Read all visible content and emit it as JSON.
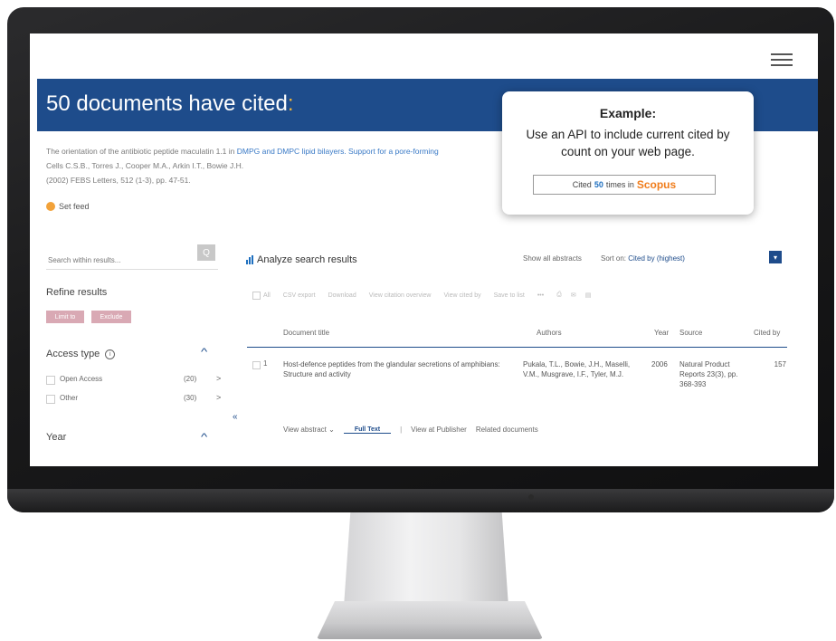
{
  "header": {
    "title_main": "50 documents have cited",
    "title_colon": ":"
  },
  "citation": {
    "line1_before": "The orientation of the antibiotic peptide maculatin 1.1 in ",
    "line1_link": "DMPG and DMPC lipid bilayers. Support for a pore-forming",
    "line2": "Cells C.S.B., Torres J., Cooper M.A., Arkin I.T., Bowie J.H.",
    "line3": "(2002) FEBS Letters, 512 (1-3), pp. 47-51.",
    "set_feed": "Set feed"
  },
  "callout": {
    "heading": "Example:",
    "body": "Use an API to include current cited by count on your web page.",
    "badge_before": "Cited",
    "badge_number": "50",
    "badge_after": "times in",
    "badge_brand": "Scopus"
  },
  "sidebar": {
    "search_placeholder": "Search within results...",
    "search_button": "Q",
    "refine_title": "Refine results",
    "limit_label": "Limit to",
    "exclude_label": "Exclude",
    "access_type": {
      "title": "Access type",
      "info": "i",
      "items": [
        {
          "label": "Open Access",
          "count": "(20)"
        },
        {
          "label": "Other",
          "count": "(30)"
        }
      ]
    },
    "year_title": "Year"
  },
  "results": {
    "analyze_label": "Analyze search results",
    "show_abstracts": "Show all abstracts",
    "sort_on_label": "Sort on:",
    "sort_value": "Cited by (highest)",
    "toolbar": {
      "all": "All",
      "items": [
        "CSV export",
        "Download",
        "View citation overview",
        "View cited by",
        "Save to list",
        "•••"
      ],
      "icons": [
        "print-icon",
        "email-icon",
        "bibliography-icon"
      ]
    },
    "columns": {
      "title": "Document title",
      "authors": "Authors",
      "year": "Year",
      "source": "Source",
      "cited_by": "Cited by"
    },
    "rows": [
      {
        "num": "1",
        "title": "Host-defence peptides from the glandular secretions of amphibians: Structure and activity",
        "authors": "Pukala, T.L., Bowie, J.H., Maselli, V.M., Musgrave, I.F., Tyler, M.J.",
        "year": "2006",
        "source": "Natural Product Reports 23(3), pp. 368-393",
        "cited_by": "157"
      }
    ],
    "row_actions": {
      "view_abstract": "View abstract",
      "full_text": "Full Text",
      "view_at_publisher": "View at Publisher",
      "related_documents": "Related documents"
    }
  },
  "colors": {
    "banner": "#1e4c8b",
    "scopus_orange": "#f07d1c",
    "link_blue": "#3a7ac6"
  }
}
